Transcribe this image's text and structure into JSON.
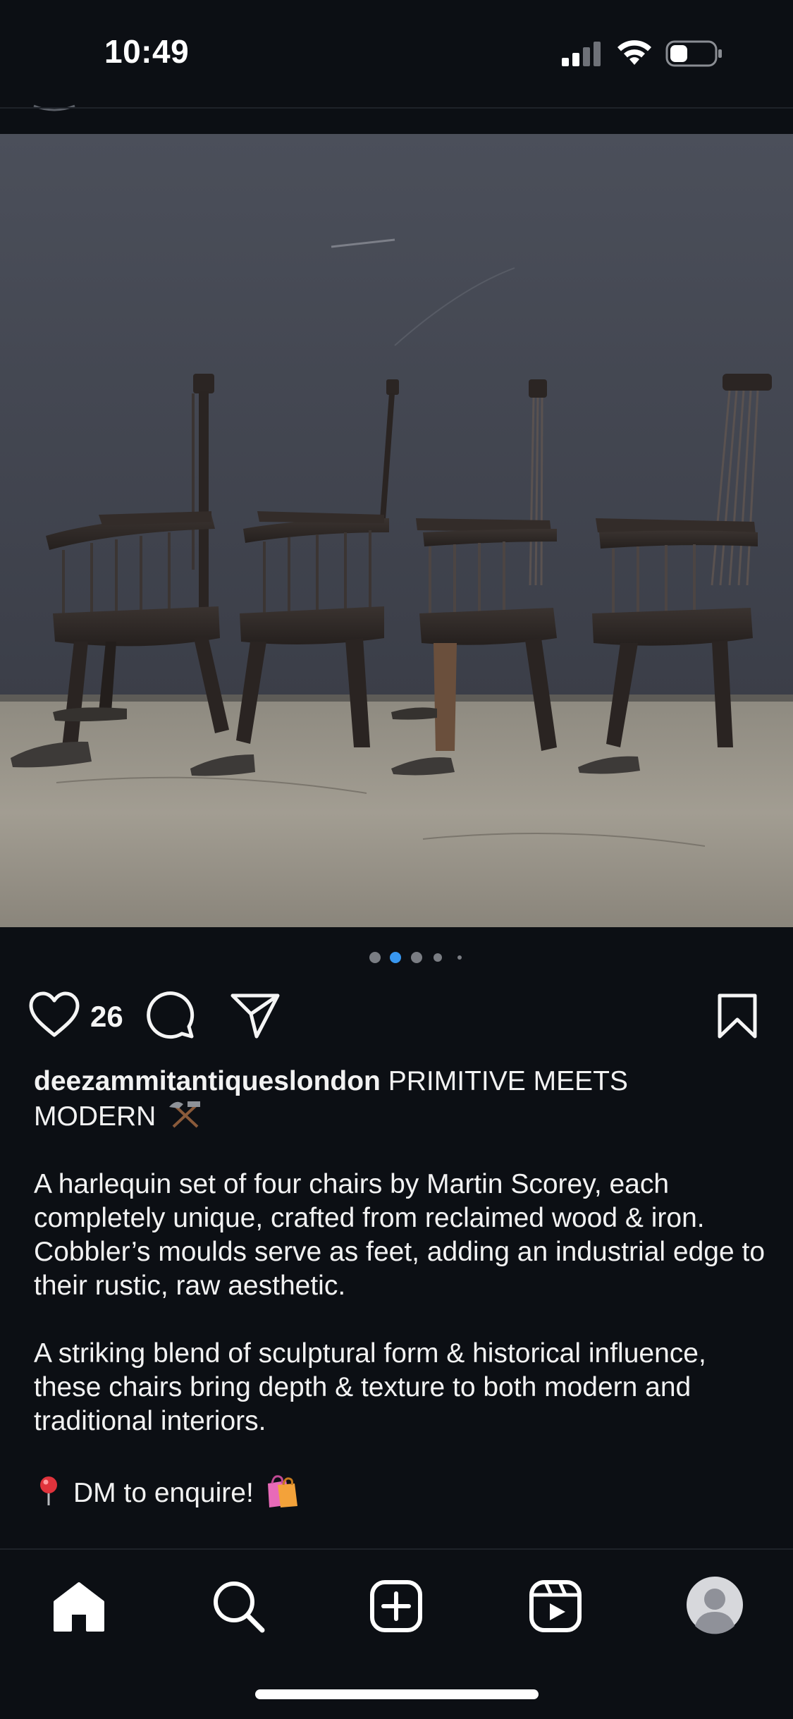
{
  "status_bar": {
    "time": "10:49"
  },
  "post": {
    "like_count": "26",
    "carousel": {
      "total": 5,
      "active_index": 1
    },
    "caption": {
      "username": "deezammitantiqueslondon",
      "headline_line1": " PRIMITIVE MEETS",
      "headline_line2": "MODERN",
      "paragraph1": "A harlequin set of four chairs by Martin Scorey, each completely unique, crafted from reclaimed wood & iron. Cobbler’s moulds serve as feet, adding an industrial edge to their rustic, raw aesthetic.",
      "paragraph2": "A striking blend of sculptural form & historical influence, these chairs bring depth & texture to both modern and traditional interiors.",
      "cta": "DM to enquire!"
    }
  },
  "nav": {
    "items": [
      "home",
      "search",
      "create",
      "reels",
      "profile"
    ],
    "active": "home"
  },
  "colors": {
    "background": "#0c0f14",
    "accent_dot": "#3897f0",
    "text": "#f5f5f5"
  },
  "icons": {
    "like": "heart-icon",
    "comment": "comment-icon",
    "share": "send-icon",
    "save": "bookmark-icon",
    "caption_emoji": "hammer-and-pick-icon",
    "pin": "round-pushpin-icon",
    "bag": "shopping-bags-icon"
  }
}
